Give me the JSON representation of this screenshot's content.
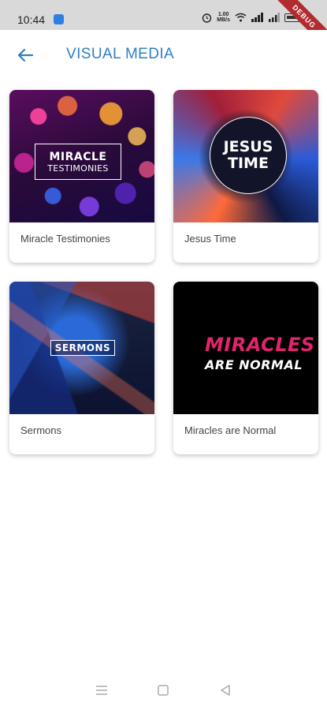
{
  "status_bar": {
    "time": "10:44",
    "network_speed": "1.00\nMB/s",
    "debug_label": "DEBUG"
  },
  "header": {
    "title": "VISUAL MEDIA",
    "back_icon": "arrow-left-icon"
  },
  "cards": [
    {
      "title": "Miracle Testimonies",
      "artwork": {
        "line1": "MIRACLE",
        "line2": "TESTIMONIES"
      }
    },
    {
      "title": "Jesus Time",
      "artwork": {
        "line1": "JESUS",
        "line2": "TIME"
      }
    },
    {
      "title": "Sermons",
      "artwork": {
        "line1": "SERMONS"
      }
    },
    {
      "title": "Miracles are Normal",
      "artwork": {
        "line1": "MIRACLES",
        "line2": "ARE NORMAL"
      }
    }
  ],
  "nav_bar": {
    "icons": [
      "menu-icon",
      "home-square-icon",
      "back-triangle-icon"
    ]
  },
  "colors": {
    "accent": "#2f7fc0",
    "status_bar_bg": "#d9d9d9",
    "debug_ribbon": "#b12c2f"
  }
}
